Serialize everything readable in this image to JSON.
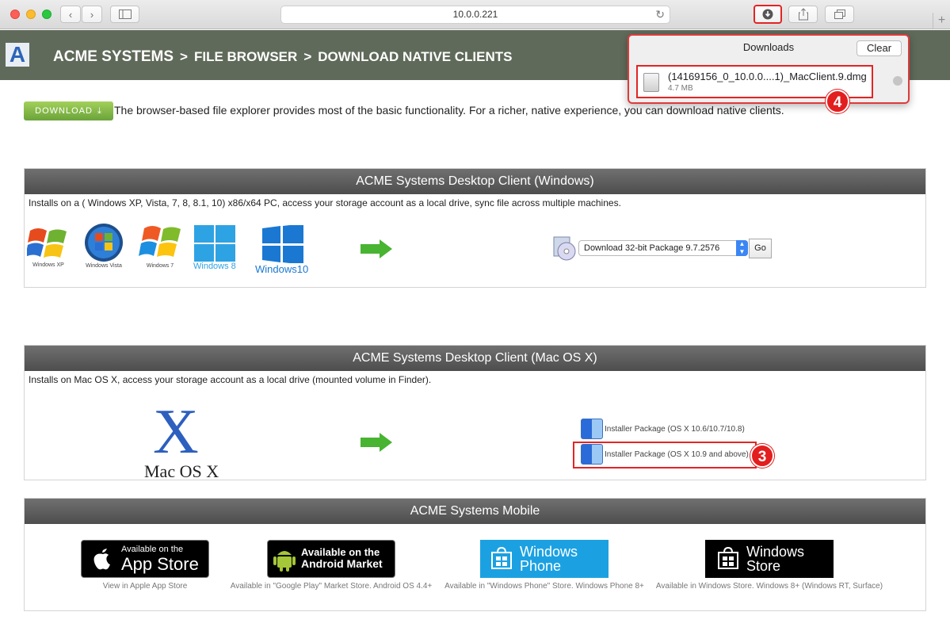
{
  "browser": {
    "url": "10.0.0.221"
  },
  "header": {
    "logo_letter": "A",
    "crumb1": "ACME SYSTEMS",
    "sep1": ">",
    "crumb2": "FILE BROWSER",
    "sep2": ">",
    "crumb3": "DOWNLOAD NATIVE CLIENTS"
  },
  "intro": {
    "download_label": "DOWNLOAD",
    "text": "The browser-based file explorer provides most of the basic functionality. For a richer, native experience, you can download native clients."
  },
  "windows_panel": {
    "title": "ACME Systems Desktop Client (Windows)",
    "desc": "Installs on a ( Windows XP, Vista, 7, 8, 8.1, 10) x86/x64 PC, access your storage account as a local drive, sync file across multiple machines.",
    "logos": [
      "Windows XP",
      "Windows Vista",
      "Windows 7",
      "Windows 8",
      "Windows10"
    ],
    "select_value": "Download 32-bit Package 9.7.2576",
    "go_label": "Go"
  },
  "mac_panel": {
    "title": "ACME Systems Desktop Client (Mac OS X)",
    "desc": "Installs on Mac OS X, access your storage account as a local drive (mounted volume in Finder).",
    "logo_x": "X",
    "logo_text": "Mac OS X",
    "pkg1": "Installer Package (OS X 10.6/10.7/10.8)",
    "pkg2": "Installer Package (OS X 10.9 and above)"
  },
  "mobile_panel": {
    "title": "ACME Systems Mobile",
    "stores": [
      {
        "line1": "Available on the",
        "line2": "App Store",
        "caption": "View in Apple App Store"
      },
      {
        "line1": "Available on the",
        "line2": "Android Market",
        "caption": "Available in \"Google Play\" Market Store. Android OS 4.4+"
      },
      {
        "line1": "Windows",
        "line2": "Phone",
        "caption": "Available in \"Windows Phone\" Store. Windows Phone 8+"
      },
      {
        "line1": "Windows",
        "line2": "Store",
        "caption": "Available in Windows Store. Windows 8+ (Windows RT, Surface)"
      }
    ]
  },
  "downloads": {
    "title": "Downloads",
    "clear_label": "Clear",
    "file_name": "(14169156_0_10.0.0....1)_MacClient.9.dmg",
    "file_size": "4.7 MB"
  },
  "annotations": {
    "badge3": "3",
    "badge4": "4"
  },
  "colors": {
    "header_bg": "#606a5a",
    "panel_title_bg": "#5a5a5a",
    "annotation_red": "#e32424",
    "download_green": "#7db443"
  }
}
